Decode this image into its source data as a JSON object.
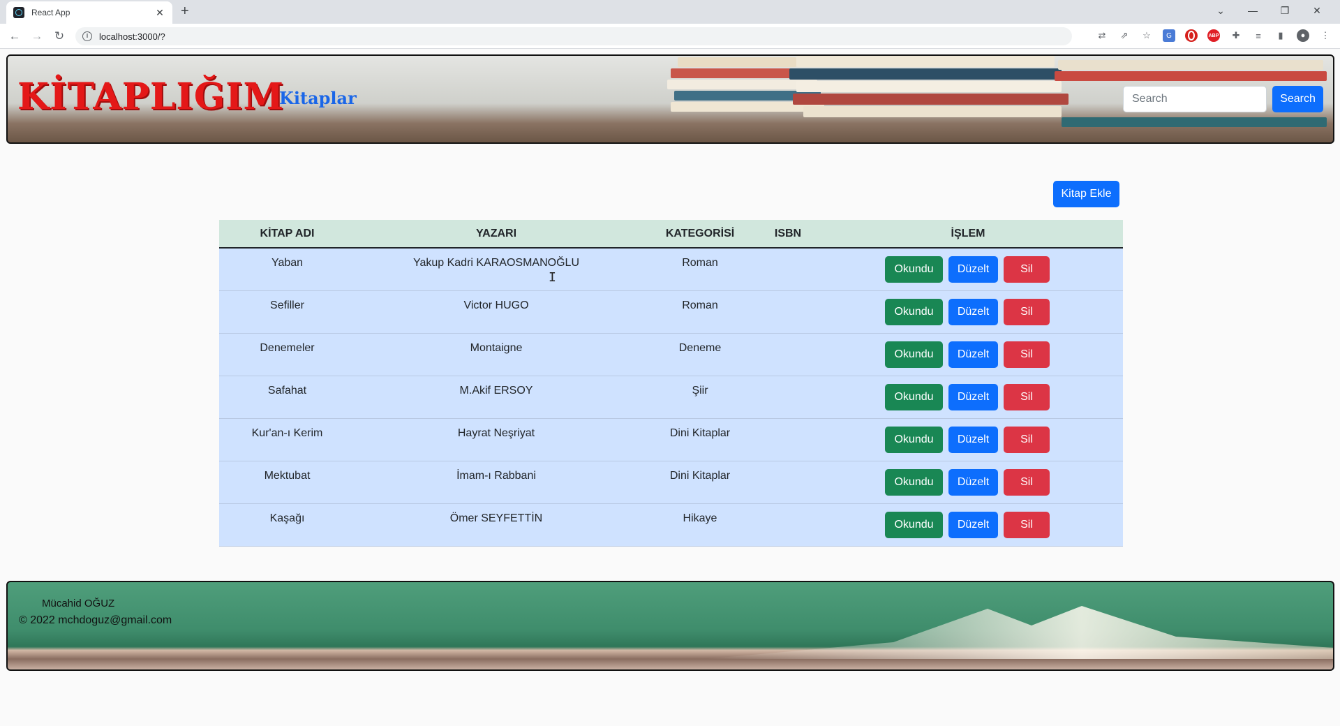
{
  "browser": {
    "tab_title": "React App",
    "url": "localhost:3000/?"
  },
  "header": {
    "brand": "KİTAPLIĞIM",
    "nav_link": "Kitaplar",
    "search_placeholder": "Search",
    "search_button": "Search"
  },
  "actions": {
    "add_book": "Kitap Ekle"
  },
  "table": {
    "columns": [
      "KİTAP ADI",
      "YAZARI",
      "KATEGORİSİ",
      "ISBN",
      "İŞLEM"
    ],
    "rows": [
      {
        "title": "Yaban",
        "author": "Yakup Kadri KARAOSMANOĞLU",
        "category": "Roman",
        "isbn": ""
      },
      {
        "title": "Sefiller",
        "author": "Victor HUGO",
        "category": "Roman",
        "isbn": ""
      },
      {
        "title": "Denemeler",
        "author": "Montaigne",
        "category": "Deneme",
        "isbn": ""
      },
      {
        "title": "Safahat",
        "author": "M.Akif ERSOY",
        "category": "Şiir",
        "isbn": ""
      },
      {
        "title": "Kur'an-ı Kerim",
        "author": "Hayrat Neşriyat",
        "category": "Dini Kitaplar",
        "isbn": ""
      },
      {
        "title": "Mektubat",
        "author": "İmam-ı Rabbani",
        "category": "Dini Kitaplar",
        "isbn": ""
      },
      {
        "title": "Kaşağı",
        "author": "Ömer SEYFETTİN",
        "category": "Hikaye",
        "isbn": ""
      }
    ],
    "buttons": {
      "read": "Okundu",
      "edit": "Düzelt",
      "delete": "Sil"
    }
  },
  "footer": {
    "name": "Mücahid OĞUZ",
    "copyright": "© 2022 mchdoguz@gmail.com"
  },
  "colors": {
    "brand": "#e41818",
    "primary": "#0d6efd",
    "success": "#198754",
    "danger": "#dc3545",
    "table_head": "#d1e7dd",
    "table_row": "#cfe2ff"
  }
}
